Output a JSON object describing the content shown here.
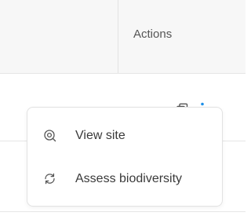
{
  "table": {
    "header": {
      "actions_label": "Actions"
    }
  },
  "row": {
    "icons": [
      "copy-icon",
      "more-vertical-icon"
    ]
  },
  "menu": {
    "items": [
      {
        "label": "View site",
        "icon": "view-site-icon"
      },
      {
        "label": "Assess biodiversity",
        "icon": "refresh-icon"
      }
    ]
  },
  "colors": {
    "header_bg": "#f7f7f7",
    "divider": "#e6e6e6",
    "accent": "#1d8fe8",
    "text": "#3a3a3a",
    "icon": "#555555"
  }
}
